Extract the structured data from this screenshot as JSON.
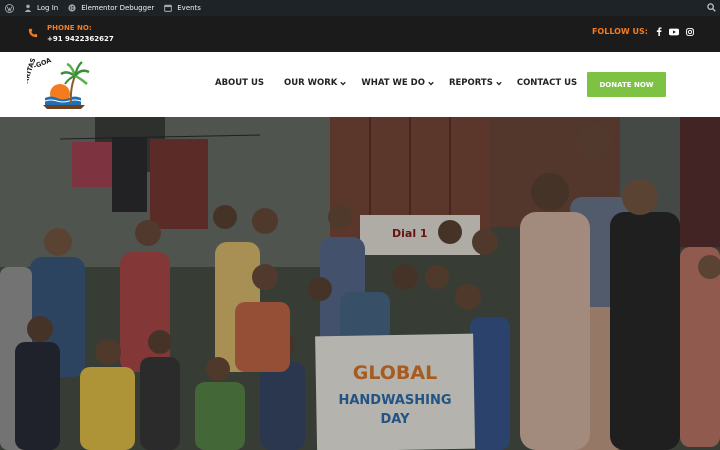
{
  "adminbar": {
    "login_label": "Log In",
    "debugger_label": "Elementor Debugger",
    "events_label": "Events"
  },
  "topbar": {
    "phone_label": "PHONE NO:",
    "phone_number": "+91 9422362627",
    "follow_label": "FOLLOW US:",
    "social_icons": [
      "facebook-icon",
      "youtube-icon",
      "instagram-icon"
    ]
  },
  "brand": {
    "logo_text": "CARITAS-GOA"
  },
  "nav": {
    "items": [
      {
        "label": "ABOUT US",
        "dropdown": false
      },
      {
        "label": "OUR WORK",
        "dropdown": true
      },
      {
        "label": "WHAT WE DO",
        "dropdown": true
      },
      {
        "label": "REPORTS",
        "dropdown": true
      },
      {
        "label": "CONTACT US",
        "dropdown": false
      }
    ],
    "donate_label": "DONATE NOW"
  },
  "hero": {
    "sign_line1": "GLOBAL",
    "sign_line2": "HANDWASHING",
    "sign_line3": "DAY",
    "poster_text": "Dial 1"
  },
  "colors": {
    "accent_orange": "#f47c20",
    "donate_green": "#7dc243",
    "topbar_bg": "#1b1b1b",
    "adminbar_bg": "#1d2327"
  }
}
